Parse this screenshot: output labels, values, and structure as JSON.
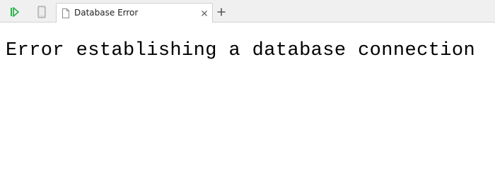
{
  "toolbar": {
    "play_icon": "play-step-icon",
    "device_icon": "mobile-device-icon"
  },
  "tab": {
    "title": "Database Error",
    "page_icon": "document-icon",
    "close_icon": "close-icon"
  },
  "new_tab_icon": "plus-icon",
  "page": {
    "heading": "Error establishing a database connection"
  },
  "colors": {
    "play_icon": "#2bb24c",
    "tabbar_bg": "#f0f0f0",
    "tab_bg": "#ffffff",
    "text": "#000000"
  }
}
